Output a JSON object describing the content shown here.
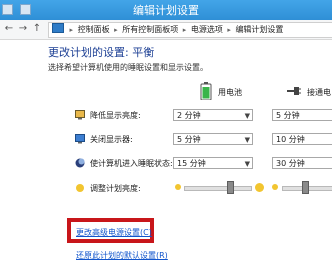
{
  "window": {
    "title": "编辑计划设置"
  },
  "address_bar": {
    "crumbs": [
      "控制面板",
      "所有控制面板项",
      "电源选项",
      "编辑计划设置"
    ]
  },
  "main": {
    "heading": "更改计划的设置: 平衡",
    "subtitle": "选择希望计算机使用的睡眠设置和显示设置。"
  },
  "columns": {
    "battery": "用电池",
    "plugged": "接通电"
  },
  "settings": {
    "dim_display": {
      "label": "降低显示亮度:",
      "battery": "2 分钟",
      "plugged": "5 分钟"
    },
    "turn_off_display": {
      "label": "关闭显示器:",
      "battery": "5 分钟",
      "plugged": "10 分钟"
    },
    "sleep": {
      "label": "使计算机进入睡眠状态:",
      "battery": "15 分钟",
      "plugged": "30 分钟"
    },
    "brightness": {
      "label": "调整计划亮度:",
      "battery_level": 0.7,
      "plugged_level": 0.8
    }
  },
  "links": {
    "advanced": "更改高级电源设置(C)",
    "restore": "还原此计划的默认设置(R)"
  },
  "icons": {
    "dim_display": "monitor-dim-icon",
    "turn_off_display": "monitor-icon",
    "sleep": "moon-icon",
    "brightness": "sun-icon",
    "battery": "battery-icon",
    "plugged": "power-plug-icon"
  },
  "colors": {
    "titlebar": "#2f8fd6",
    "heading": "#1c3f94",
    "link": "#1155cc",
    "highlight": "#c8161a"
  }
}
